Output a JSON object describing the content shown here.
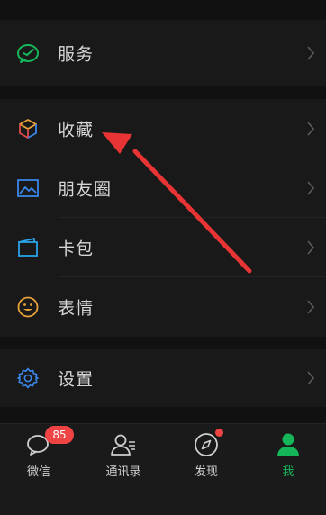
{
  "menu": {
    "services": {
      "label": "服务",
      "icon": "wechat-pay-icon",
      "color": "#15b65a"
    },
    "items": [
      {
        "label": "收藏",
        "icon": "cube-icon"
      },
      {
        "label": "朋友圈",
        "icon": "image-icon",
        "color": "#3a86e8"
      },
      {
        "label": "卡包",
        "icon": "card-icon",
        "color": "#2aa3e8"
      },
      {
        "label": "表情",
        "icon": "smile-icon",
        "color": "#e8a23a"
      }
    ],
    "settings": {
      "label": "设置",
      "icon": "gear-icon",
      "color": "#3a86e8"
    }
  },
  "tabbar": {
    "tabs": [
      {
        "label": "微信",
        "icon": "chat-icon",
        "badge": "85"
      },
      {
        "label": "通讯录",
        "icon": "contacts-icon"
      },
      {
        "label": "发现",
        "icon": "compass-icon"
      },
      {
        "label": "我",
        "icon": "person-icon",
        "active": true
      }
    ],
    "active_color": "#15b65a"
  },
  "annotation": {
    "color": "#e83434"
  }
}
